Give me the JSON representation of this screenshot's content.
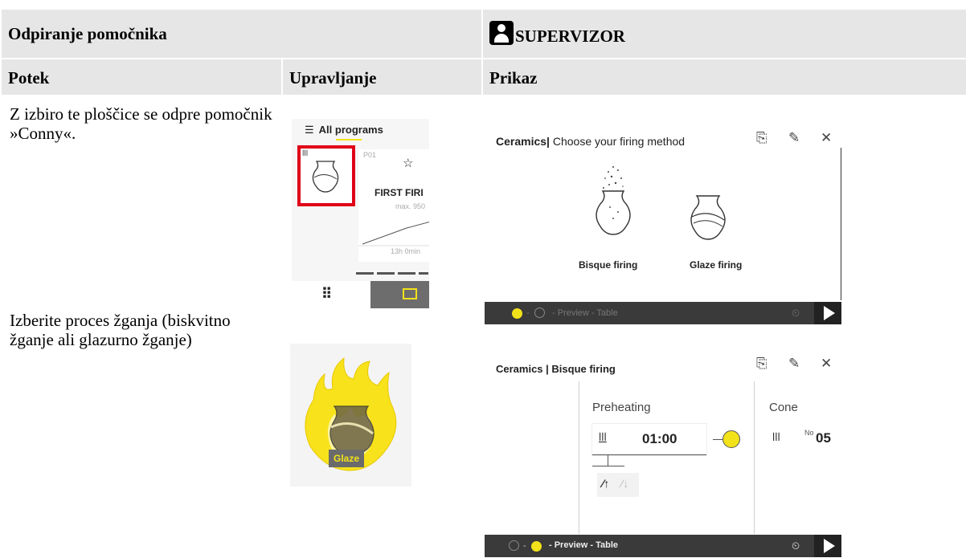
{
  "header": {
    "left_title": "Odpiranje pomočnika",
    "right_title": "SUPERVIZOR"
  },
  "columns": {
    "potek": "Potek",
    "upravljanje": "Upravljanje",
    "prikaz": "Prikaz"
  },
  "rows": [
    {
      "text": "Z izbiro te ploščice se odpre pomočnik »Conny«."
    },
    {
      "text": "Izberite proces žganja (biskvitno žganje ali glazurno žganje)"
    }
  ],
  "shot1": {
    "menu_label": "All programs",
    "program_no": "P01",
    "program_name": "FIRST FIRI",
    "max_temp": "max. 950",
    "duration": "13h 0min"
  },
  "shot2": {
    "category": "Ceramics",
    "subtitle": "Choose your firing method",
    "option1": "Bisque firing",
    "option2": "Glaze firing",
    "steps": "- Preview - Table"
  },
  "shot3": {
    "badge": "Glaze"
  },
  "shot4": {
    "title": "Ceramics | Bisque firing",
    "segment1": "Preheating",
    "segment1_time": "01:00",
    "segment2": "Cone",
    "cone_prefix": "No",
    "cone_value": "05",
    "steps": "- Preview - Table"
  }
}
